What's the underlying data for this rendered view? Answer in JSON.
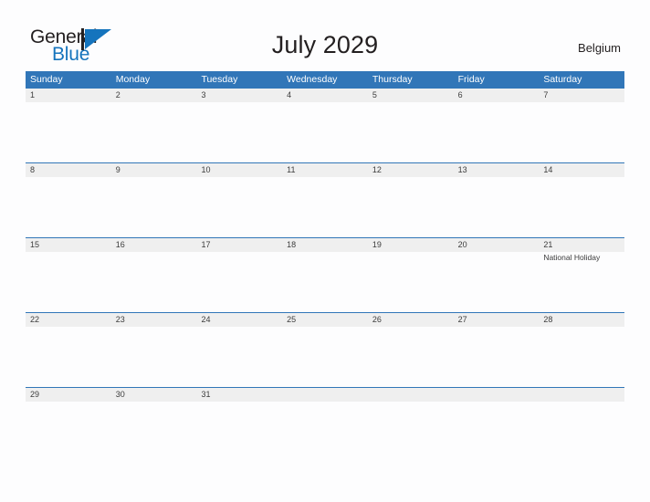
{
  "brand": {
    "name_part1": "General",
    "name_part2": "Blue",
    "logo_icon": "general-blue-flag-logo",
    "primary_color": "#1574bd",
    "text_color": "#231f20"
  },
  "header": {
    "title": "July 2029",
    "country": "Belgium"
  },
  "theme": {
    "header_blue": "#3176b8",
    "date_band_gray": "#efefef",
    "page_background": "#fdfdfe",
    "text": "#3c3c3c"
  },
  "calendar": {
    "month": "July",
    "year": "2029",
    "weekday_headers": [
      "Sunday",
      "Monday",
      "Tuesday",
      "Wednesday",
      "Thursday",
      "Friday",
      "Saturday"
    ],
    "weeks": [
      {
        "days": [
          {
            "num": "1",
            "events": []
          },
          {
            "num": "2",
            "events": []
          },
          {
            "num": "3",
            "events": []
          },
          {
            "num": "4",
            "events": []
          },
          {
            "num": "5",
            "events": []
          },
          {
            "num": "6",
            "events": []
          },
          {
            "num": "7",
            "events": []
          }
        ]
      },
      {
        "days": [
          {
            "num": "8",
            "events": []
          },
          {
            "num": "9",
            "events": []
          },
          {
            "num": "10",
            "events": []
          },
          {
            "num": "11",
            "events": []
          },
          {
            "num": "12",
            "events": []
          },
          {
            "num": "13",
            "events": []
          },
          {
            "num": "14",
            "events": []
          }
        ]
      },
      {
        "days": [
          {
            "num": "15",
            "events": []
          },
          {
            "num": "16",
            "events": []
          },
          {
            "num": "17",
            "events": []
          },
          {
            "num": "18",
            "events": []
          },
          {
            "num": "19",
            "events": []
          },
          {
            "num": "20",
            "events": []
          },
          {
            "num": "21",
            "events": [
              "National Holiday"
            ]
          }
        ]
      },
      {
        "days": [
          {
            "num": "22",
            "events": []
          },
          {
            "num": "23",
            "events": []
          },
          {
            "num": "24",
            "events": []
          },
          {
            "num": "25",
            "events": []
          },
          {
            "num": "26",
            "events": []
          },
          {
            "num": "27",
            "events": []
          },
          {
            "num": "28",
            "events": []
          }
        ]
      },
      {
        "days": [
          {
            "num": "29",
            "events": []
          },
          {
            "num": "30",
            "events": []
          },
          {
            "num": "31",
            "events": []
          },
          {
            "num": "",
            "events": []
          },
          {
            "num": "",
            "events": []
          },
          {
            "num": "",
            "events": []
          },
          {
            "num": "",
            "events": []
          }
        ]
      }
    ]
  }
}
